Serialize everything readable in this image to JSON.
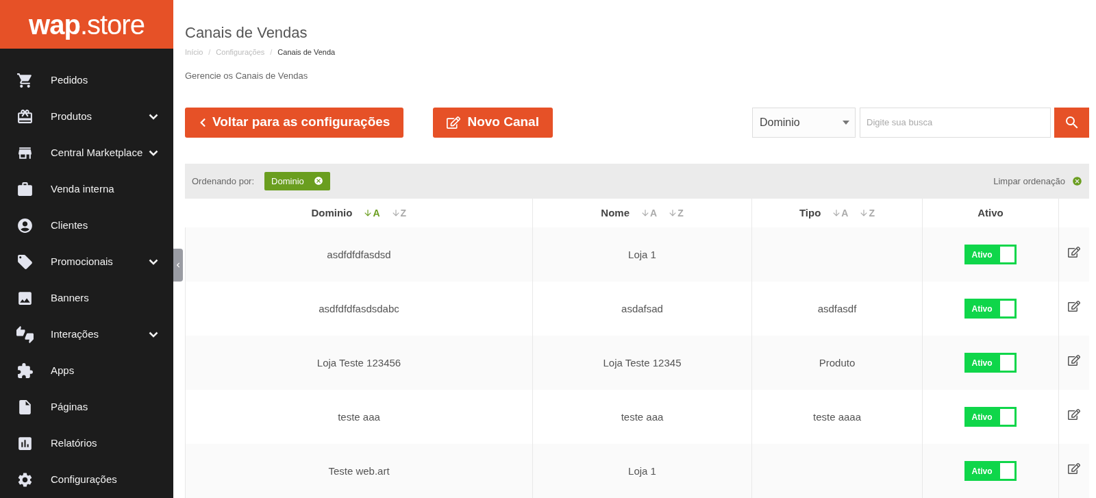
{
  "logo": {
    "bold": "wap",
    "light": ".store"
  },
  "sidebar": {
    "items": [
      {
        "label": "Pedidos",
        "expandable": false
      },
      {
        "label": "Produtos",
        "expandable": true
      },
      {
        "label": "Central Marketplace",
        "expandable": true
      },
      {
        "label": "Venda interna",
        "expandable": false
      },
      {
        "label": "Clientes",
        "expandable": false
      },
      {
        "label": "Promocionais",
        "expandable": true
      },
      {
        "label": "Banners",
        "expandable": false
      },
      {
        "label": "Interações",
        "expandable": true
      },
      {
        "label": "Apps",
        "expandable": false
      },
      {
        "label": "Páginas",
        "expandable": false
      },
      {
        "label": "Relatórios",
        "expandable": false
      },
      {
        "label": "Configurações",
        "expandable": false
      }
    ]
  },
  "page": {
    "title": "Canais de Vendas",
    "breadcrumb": [
      "Início",
      "Configurações",
      "Canais de Venda"
    ],
    "breadcrumb_separators": [
      "/",
      "/"
    ],
    "subtitle": "Gerencie os Canais de Vendas"
  },
  "buttons": {
    "back": "Voltar para as configurações",
    "new": "Novo Canal"
  },
  "search": {
    "filter": "Dominio",
    "placeholder": "Digite sua busca"
  },
  "sorting": {
    "label": "Ordenando por:",
    "chip": "Dominio",
    "clear": "Limpar ordenação"
  },
  "table": {
    "columns": [
      {
        "label": "Dominio",
        "sort": [
          {
            "label": "A",
            "selected": true
          },
          {
            "label": "Z",
            "selected": false
          }
        ]
      },
      {
        "label": "Nome",
        "sort": [
          {
            "label": "A",
            "selected": false
          },
          {
            "label": "Z",
            "selected": false
          }
        ]
      },
      {
        "label": "Tipo",
        "sort": [
          {
            "label": "A",
            "selected": false
          },
          {
            "label": "Z",
            "selected": false
          }
        ]
      },
      {
        "label": "Ativo"
      }
    ],
    "rows": [
      {
        "dominio": "asdfdfdfasdsd",
        "nome": "Loja 1",
        "status": "Ativo",
        "active": true
      },
      {
        "dominio": "asdfdfdfasdsdabc",
        "nome": "asdafsad",
        "tipo": "asdfasdf",
        "status": "Ativo",
        "active": true
      },
      {
        "dominio": "Loja Teste 123456",
        "nome": "Loja Teste 12345",
        "tipo": "Produto",
        "status": "Ativo",
        "active": true
      },
      {
        "dominio": "teste aaa",
        "nome": "teste aaa",
        "tipo": "teste aaaa",
        "status": "Ativo",
        "active": true
      },
      {
        "dominio": "Teste web.art",
        "nome": "Loja 1",
        "status": "Ativo",
        "active": true
      }
    ]
  }
}
